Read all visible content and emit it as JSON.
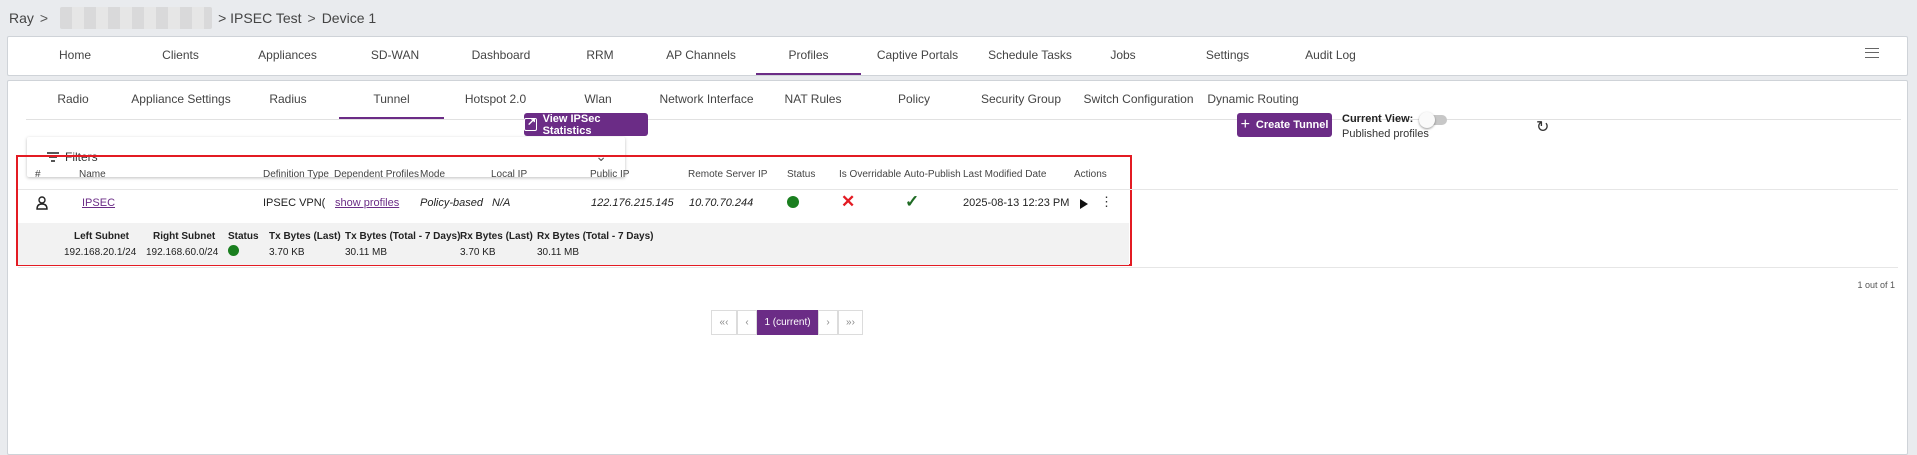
{
  "breadcrumb": {
    "root": "Ray",
    "separator": ">",
    "project": "IPSEC Test",
    "device": "Device 1"
  },
  "main_nav": [
    "Home",
    "Clients",
    "Appliances",
    "SD-WAN",
    "Dashboard",
    "RRM",
    "AP Channels",
    "Profiles",
    "Captive Portals",
    "Schedule Tasks",
    "Jobs",
    "Settings",
    "Audit Log"
  ],
  "main_nav_active": "Profiles",
  "sub_nav": [
    "Radio",
    "Appliance Settings",
    "Radius",
    "Tunnel",
    "Hotspot 2.0",
    "Wlan",
    "Network Interface",
    "NAT Rules",
    "Policy",
    "Security Group",
    "Switch Configuration",
    "Dynamic Routing"
  ],
  "sub_nav_active": "Tunnel",
  "toolbar": {
    "filters_label": "Filters",
    "view_stats_label": "View IPSec Statistics",
    "create_label": "Create Tunnel",
    "current_view_label": "Current View:",
    "current_view_value": "Published profiles"
  },
  "table": {
    "columns": [
      "#",
      "Name",
      "Definition Type",
      "Dependent Profiles",
      "Mode",
      "Local IP",
      "Public IP",
      "Remote Server IP",
      "Status",
      "Is Overridable",
      "Auto-Publish",
      "Last Modified Date",
      "Actions"
    ],
    "row": {
      "name": "IPSEC",
      "definition_type": "IPSEC VPN(IKE",
      "dependent_profiles": "show profiles",
      "mode": "Policy-based",
      "local_ip": "N/A",
      "public_ip": "122.176.215.145",
      "remote_server_ip": "10.70.70.244",
      "status": "up",
      "is_overridable": "no",
      "auto_publish": "yes",
      "last_modified": "2025-08-13 12:23 PM"
    },
    "detail_columns": [
      "Left Subnet",
      "Right Subnet",
      "Status",
      "Tx Bytes (Last)",
      "Tx Bytes (Total - 7 Days)",
      "Rx Bytes (Last)",
      "Rx Bytes (Total - 7 Days)"
    ],
    "detail_values": {
      "left_subnet": "192.168.20.1/24",
      "right_subnet": "192.168.60.0/24",
      "tx_last": "3.70 KB",
      "tx_total": "30.11 MB",
      "rx_last": "3.70 KB",
      "rx_total": "30.11 MB"
    }
  },
  "pagination": {
    "summary": "1 out of 1",
    "first": "«‹",
    "prev": "‹",
    "current": "1 (current)",
    "next": "›",
    "last": "»›"
  },
  "colors": {
    "brand": "#6b2c86",
    "status_ok": "#1a7f1f",
    "error": "#e31b23"
  }
}
